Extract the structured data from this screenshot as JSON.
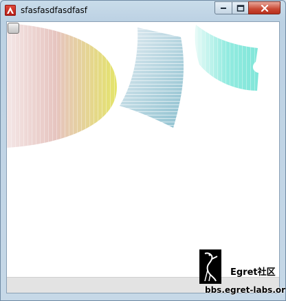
{
  "window": {
    "title": "sfasfasdfasdfasf",
    "controls": {
      "minimize": "minimize",
      "maximize": "maximize",
      "close": "close"
    }
  },
  "watermark": {
    "brand": "Egret社区",
    "url": "bbs.egret-labs.org"
  },
  "colors": {
    "shape_left_start": "#f2dede",
    "shape_left_end": "#e6e266",
    "shape_mid_start": "#dbe6ee",
    "shape_mid_end": "#93c3d2",
    "shape_right_start": "#d8f7f2",
    "shape_right_end": "#85e8dc"
  },
  "icons": {
    "app": "adobe-air-icon",
    "logo": "egret-bird-logo-icon"
  }
}
